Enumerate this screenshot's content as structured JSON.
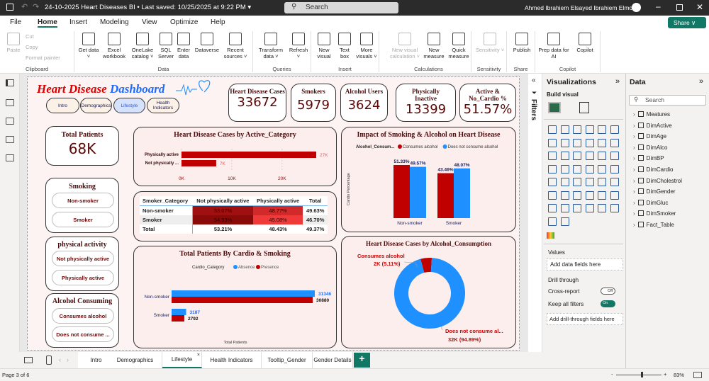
{
  "titlebar": {
    "title": "24-10-2025 Heart Diseases BI • Last saved: 10/25/2025 at 9:22 PM ▾",
    "search_placeholder": "Search",
    "user": "Ahmed Ibrahiem Elsayed Ibrahiem Elmohr"
  },
  "menu": [
    "File",
    "Home",
    "Insert",
    "Modeling",
    "View",
    "Optimize",
    "Help"
  ],
  "share_label": "Share ∨",
  "ribbon": {
    "groups": [
      {
        "label": "Clipboard",
        "buttons": [
          "Paste"
        ],
        "small": [
          "Cut",
          "Copy",
          "Format painter"
        ]
      },
      {
        "label": "Data",
        "buttons": [
          "Get data ˅",
          "Excel workbook",
          "OneLake catalog ˅",
          "SQL Server",
          "Enter data",
          "Dataverse",
          "Recent sources ˅"
        ]
      },
      {
        "label": "Queries",
        "buttons": [
          "Transform data ˅",
          "Refresh ˅"
        ]
      },
      {
        "label": "Insert",
        "buttons": [
          "New visual",
          "Text box",
          "More visuals ˅"
        ]
      },
      {
        "label": "Calculations",
        "buttons": [
          "New visual calculation ˅",
          "New measure",
          "Quick measure"
        ]
      },
      {
        "label": "Sensitivity",
        "buttons": [
          "Sensitivity ˅"
        ]
      },
      {
        "label": "Share",
        "buttons": [
          "Publish"
        ]
      },
      {
        "label": "Copilot",
        "buttons": [
          "Prep data for AI",
          "Copilot"
        ]
      }
    ]
  },
  "dashboard": {
    "title_part1": "Heart Disease",
    "title_part2": "Dashboard",
    "nav": [
      "Intro",
      "Demographics",
      "Lifestyle",
      "Health Indicators"
    ],
    "active_nav": "Lifestyle",
    "kpis": [
      {
        "label": "Heart Disease Cases",
        "value": "33672"
      },
      {
        "label": "Smokers",
        "value": "5979"
      },
      {
        "label": "Alcohol Users",
        "value": "3624"
      },
      {
        "label": "Physically Inactive",
        "value": "13399"
      },
      {
        "label": "Active & No_Cardio %",
        "value": "51.57%"
      }
    ],
    "total_patients": {
      "label": "Total Patients",
      "value": "68K"
    },
    "slicers": [
      {
        "title": "Smoking",
        "items": [
          "Non-smoker",
          "Smoker"
        ]
      },
      {
        "title": "physical activity",
        "items": [
          "Not physically active",
          "Physically active"
        ]
      },
      {
        "title": "Alcohol Consuming",
        "items": [
          "Consumes alcohol",
          "Does not consume ..."
        ]
      }
    ],
    "matrix": {
      "headers": [
        "Smoker_Category",
        "Not physically active",
        "Physically active",
        "Total"
      ],
      "rows": [
        [
          "Non-smoker",
          "53.07%",
          "48.77%",
          "49.63%"
        ],
        [
          "Smoker",
          "54.93%",
          "45.08%",
          "46.70%"
        ],
        [
          "Total",
          "53.21%",
          "48.43%",
          "49.37%"
        ]
      ],
      "cell_colors": [
        [
          "#a01010",
          "#d12a2a"
        ],
        [
          "#8a0a0a",
          "#f03a3a"
        ]
      ]
    }
  },
  "chart_data": [
    {
      "type": "bar",
      "orientation": "horizontal",
      "title": "Heart Disease Cases by Active_Category",
      "categories": [
        "Physically active",
        "Not physically ..."
      ],
      "values": [
        26800,
        6900
      ],
      "data_labels": [
        "27K",
        "7K"
      ],
      "x_ticks": [
        "0K",
        "10K",
        "20K"
      ],
      "xlim": [
        0,
        27000
      ],
      "color": "#c00000",
      "grid": true
    },
    {
      "type": "bar",
      "title": "Impact of Smoking & Alcohol on Heart Disease",
      "legend_title": "Alcohol_Consum...",
      "ylabel": "Cardio Percentage",
      "categories": [
        "Non-smoker",
        "Smoker"
      ],
      "series": [
        {
          "name": "Consumes alcohol",
          "color": "#c00000",
          "values": [
            51.33,
            43.46
          ],
          "labels": [
            "51.33%",
            "43.46%"
          ]
        },
        {
          "name": "Does not consume alcohol",
          "color": "#1e90ff",
          "values": [
            49.57,
            48.07
          ],
          "labels": [
            "49.57%",
            "48.07%"
          ]
        }
      ],
      "ylim": [
        0,
        55
      ],
      "legend": "top"
    },
    {
      "type": "bar",
      "orientation": "horizontal",
      "title": "Total Patients By Cardio & Smoking",
      "legend_title": "Cardio_Category",
      "xlabel": "Total Patients",
      "categories": [
        "Non-smoker",
        "Smoker"
      ],
      "series": [
        {
          "name": "Absence",
          "color": "#1e90ff",
          "values": [
            31346,
            3187
          ]
        },
        {
          "name": "Presence",
          "color": "#c00000",
          "values": [
            30880,
            2792
          ]
        }
      ],
      "xlim": [
        0,
        31346
      ],
      "legend": "top"
    },
    {
      "type": "pie",
      "donut": true,
      "title": "Heart Disease Cases by Alcohol_Consumption",
      "slices": [
        {
          "name": "Consumes alcohol",
          "value": 5.11,
          "label": "2K (5.11%)",
          "color": "#c00000"
        },
        {
          "name": "Does not consume al...",
          "value": 94.89,
          "label": "32K (94.89%)",
          "color": "#1e90ff"
        }
      ]
    }
  ],
  "filters_label": "Filters",
  "viz_pane": {
    "title": "Visualizations",
    "build": "Build visual",
    "values": "Values",
    "add_data": "Add data fields here",
    "drill": "Drill through",
    "cross": "Cross-report",
    "cross_state": "Off",
    "keep": "Keep all filters",
    "keep_state": "On",
    "add_drill": "Add drill-through fields here"
  },
  "data_pane": {
    "title": "Data",
    "search_placeholder": "Search",
    "fields": [
      "Meatures",
      "DimActive",
      "DimAge",
      "DimAlco",
      "DimBP",
      "DimCardio",
      "DimCholestrol",
      "DimGender",
      "DimGluc",
      "DimSmoker",
      "Fact_Table"
    ]
  },
  "page_tabs": [
    "Intro",
    "Demographics",
    "Lifestyle",
    "Health Indicators",
    "Tooltip_Gender",
    "Gender Details"
  ],
  "active_tab": "Lifestyle",
  "status": {
    "page": "Page 3 of 6",
    "zoom": "83%",
    "zoom_value": 83
  }
}
